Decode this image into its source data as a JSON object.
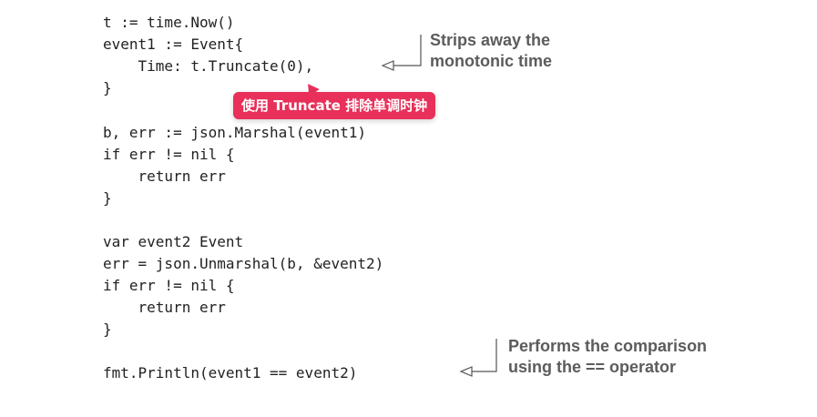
{
  "code": {
    "lines": [
      "t := time.Now()",
      "event1 := Event{",
      "    Time: t.Truncate(0),",
      "}",
      "",
      "b, err := json.Marshal(event1)",
      "if err != nil {",
      "    return err",
      "}",
      "",
      "var event2 Event",
      "err = json.Unmarshal(b, &event2)",
      "if err != nil {",
      "    return err",
      "}",
      "",
      "fmt.Println(event1 == event2)"
    ]
  },
  "annotations": {
    "truncate": {
      "line1": "Strips away the",
      "line2": "monotonic time"
    },
    "compare": {
      "line1": "Performs the comparison",
      "line2": "using the == operator"
    }
  },
  "callout": {
    "label": "使用 Truncate 排除单调时钟"
  },
  "colors": {
    "code_text": "#222222",
    "annotation_text": "#5c5c5c",
    "arrow": "#555555",
    "callout_bg": "#e8305a",
    "callout_text": "#ffffff"
  }
}
